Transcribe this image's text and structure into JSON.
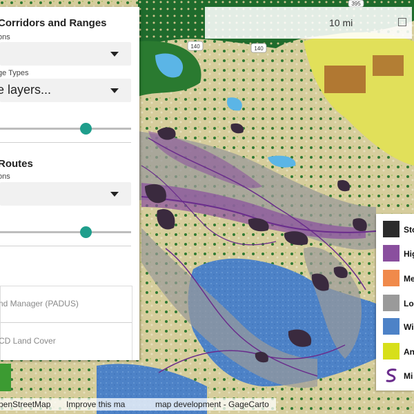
{
  "panel": {
    "section1": {
      "title": "Corridors and Ranges",
      "options_label": "ons",
      "range_types_label": "ge Types",
      "layers_placeholder": "e layers...",
      "slider_value": 0.65
    },
    "section2": {
      "title": "Routes",
      "options_label": "ons",
      "slider_value": 0.65
    },
    "layers": [
      {
        "label": "nd Manager (PADUS)"
      },
      {
        "label": "CD Land Cover"
      }
    ]
  },
  "scale": {
    "label": "10 mi"
  },
  "roads": [
    {
      "label": "140"
    },
    {
      "label": "140"
    },
    {
      "label": "395"
    }
  ],
  "legend": {
    "items": [
      {
        "label": "Sto",
        "color": "#2b2b2b"
      },
      {
        "label": "Hig",
        "color": "#8a4f9e"
      },
      {
        "label": "Me",
        "color": "#f08a4b"
      },
      {
        "label": "Lo",
        "color": "#9a9a9a"
      },
      {
        "label": "Wi",
        "color": "#4d82c7"
      },
      {
        "label": "An",
        "color": "#d7df1a"
      },
      {
        "label": "Mi",
        "color": "#6a2c8c"
      }
    ]
  },
  "attribution": {
    "osm": "penStreetMap",
    "improve": "Improve this ma",
    "dev": "map development - GageCarto"
  },
  "colors": {
    "forest": "#1f6b2c",
    "shrub": "#d7cfa0",
    "water": "#5bb5e6",
    "agri_yellow": "#e1e05a",
    "agri_brown": "#a8652b",
    "wintering_blue": "#4d82c7",
    "corridor_purple": "#8a4f9e",
    "stopover": "#3a2a3e",
    "low_gray": "#9a9a9a",
    "accent_teal": "#1f9e8c"
  }
}
